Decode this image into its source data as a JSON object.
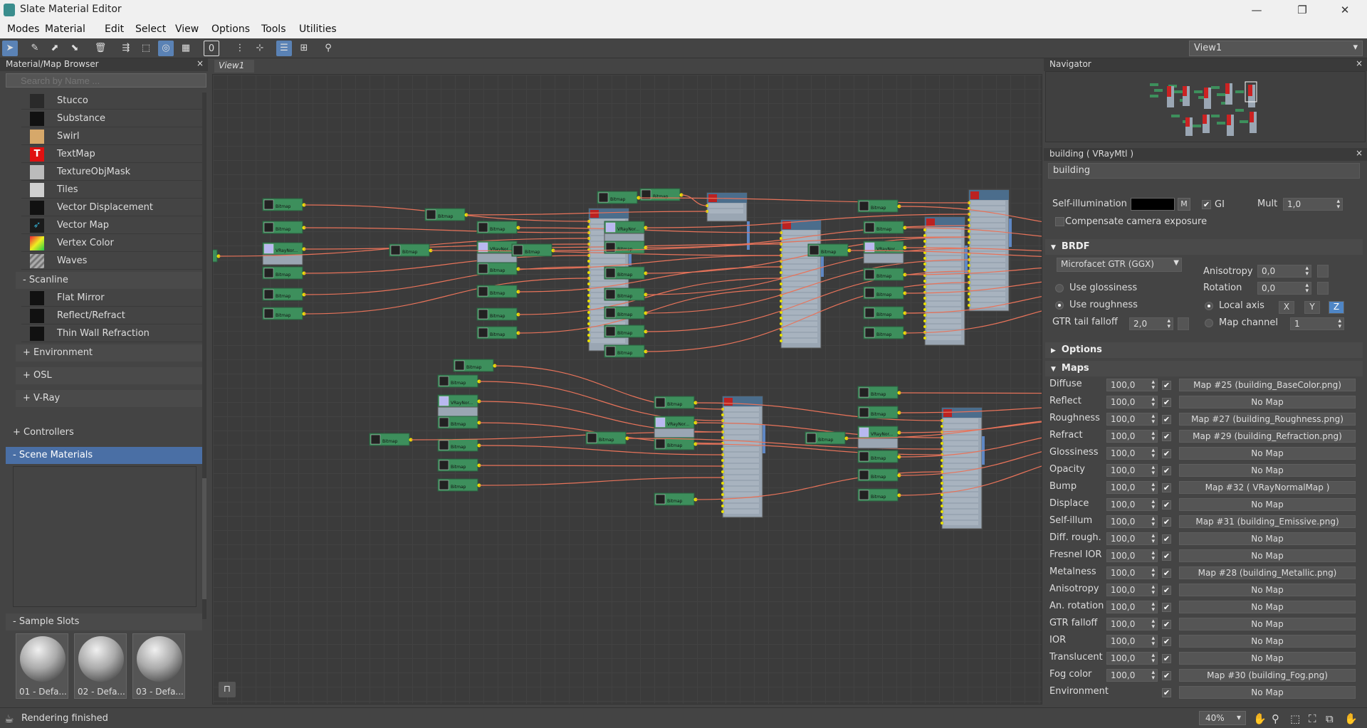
{
  "window": {
    "title": "Slate Material Editor",
    "minimize": "—",
    "restore": "❐",
    "close": "✕"
  },
  "menu": [
    "Modes",
    "Material",
    "Edit",
    "Select",
    "View",
    "Options",
    "Tools",
    "Utilities"
  ],
  "toolbar": {
    "view_select": "View1",
    "num_badge": "0"
  },
  "browser": {
    "title": "Material/Map Browser",
    "search_placeholder": "Search by Name ...",
    "maps": [
      {
        "name": "Stucco",
        "swatch": "#2a2a2a"
      },
      {
        "name": "Substance",
        "swatch": "#111111"
      },
      {
        "name": "Swirl",
        "swatch": "#d6a86a"
      },
      {
        "name": "TextMap",
        "swatch": "#e01010"
      },
      {
        "name": "TextureObjMask",
        "swatch": "#bbbbbb"
      },
      {
        "name": "Tiles",
        "swatch": "#cfcfcf"
      },
      {
        "name": "Vector Displacement",
        "swatch": "#111111"
      },
      {
        "name": "Vector Map",
        "swatch": "#1a1a1a"
      },
      {
        "name": "Vertex Color",
        "swatch": "#c8c020"
      },
      {
        "name": "Waves",
        "swatch": "#999999"
      }
    ],
    "scanline_header": "- Scanline",
    "scanline_items": [
      {
        "name": "Flat Mirror",
        "swatch": "#111111"
      },
      {
        "name": "Reflect/Refract",
        "swatch": "#111111"
      },
      {
        "name": "Thin Wall Refraction",
        "swatch": "#111111"
      }
    ],
    "groups": [
      "+ Environment",
      "+ OSL",
      "+ V-Ray"
    ],
    "controllers": "+ Controllers",
    "scene_materials": "- Scene Materials",
    "sample_slots": "- Sample Slots",
    "slots": [
      "01 - Defa...",
      "02 - Defa...",
      "03 - Defa..."
    ]
  },
  "view": {
    "tab": "View1"
  },
  "navigator": {
    "title": "Navigator"
  },
  "params": {
    "header": "building  ( VRayMtl )",
    "name": "building",
    "self_illum_label": "Self-illumination",
    "self_illum_m": "M",
    "gi_label": "GI",
    "mult_label": "Mult",
    "mult_value": "1,0",
    "compensate_label": "Compensate camera exposure",
    "brdf_title": "BRDF",
    "brdf_type": "Microfacet GTR (GGX)",
    "anisotropy_label": "Anisotropy",
    "anisotropy_value": "0,0",
    "rotation_label": "Rotation",
    "rotation_value": "0,0",
    "use_glossiness": "Use glossiness",
    "use_roughness": "Use roughness",
    "local_axis": "Local axis",
    "axes": [
      "X",
      "Y",
      "Z"
    ],
    "gtr_tail_label": "GTR tail falloff",
    "gtr_tail_value": "2,0",
    "map_channel_label": "Map channel",
    "map_channel_value": "1",
    "options_title": "Options",
    "maps_title": "Maps",
    "maps": [
      {
        "label": "Diffuse",
        "amount": "100,0",
        "map": "Map #25 (building_BaseColor.png)"
      },
      {
        "label": "Reflect",
        "amount": "100,0",
        "map": "No Map"
      },
      {
        "label": "Roughness",
        "amount": "100,0",
        "map": "Map #27 (building_Roughness.png)"
      },
      {
        "label": "Refract",
        "amount": "100,0",
        "map": "Map #29 (building_Refraction.png)"
      },
      {
        "label": "Glossiness",
        "amount": "100,0",
        "map": "No Map"
      },
      {
        "label": "Opacity",
        "amount": "100,0",
        "map": "No Map"
      },
      {
        "label": "Bump",
        "amount": "100,0",
        "map": "Map #32  ( VRayNormalMap )"
      },
      {
        "label": "Displace",
        "amount": "100,0",
        "map": "No Map"
      },
      {
        "label": "Self-illum",
        "amount": "100,0",
        "map": "Map #31 (building_Emissive.png)"
      },
      {
        "label": "Diff. rough.",
        "amount": "100,0",
        "map": "No Map"
      },
      {
        "label": "Fresnel IOR",
        "amount": "100,0",
        "map": "No Map"
      },
      {
        "label": "Metalness",
        "amount": "100,0",
        "map": "Map #28 (building_Metallic.png)"
      },
      {
        "label": "Anisotropy",
        "amount": "100,0",
        "map": "No Map"
      },
      {
        "label": "An. rotation",
        "amount": "100,0",
        "map": "No Map"
      },
      {
        "label": "GTR falloff",
        "amount": "100,0",
        "map": "No Map"
      },
      {
        "label": "IOR",
        "amount": "100,0",
        "map": "No Map"
      },
      {
        "label": "Translucent",
        "amount": "100,0",
        "map": "No Map"
      },
      {
        "label": "Fog color",
        "amount": "100,0",
        "map": "Map #30 (building_Fog.png)"
      },
      {
        "label": "Environment",
        "amount": "",
        "map": "No Map"
      }
    ]
  },
  "graph": {
    "node_label": "Bitmap",
    "normal_label": "VRayNor...",
    "mtl_title": "building",
    "mtl_type": "VRayMtl"
  },
  "status": {
    "message": "Rendering finished",
    "zoom": "40%"
  },
  "colors": {
    "accent": "#4a6fa5",
    "node_green": "#3d8f5c",
    "wire": "#e8735a",
    "mtl_body": "#9aa6b3"
  }
}
